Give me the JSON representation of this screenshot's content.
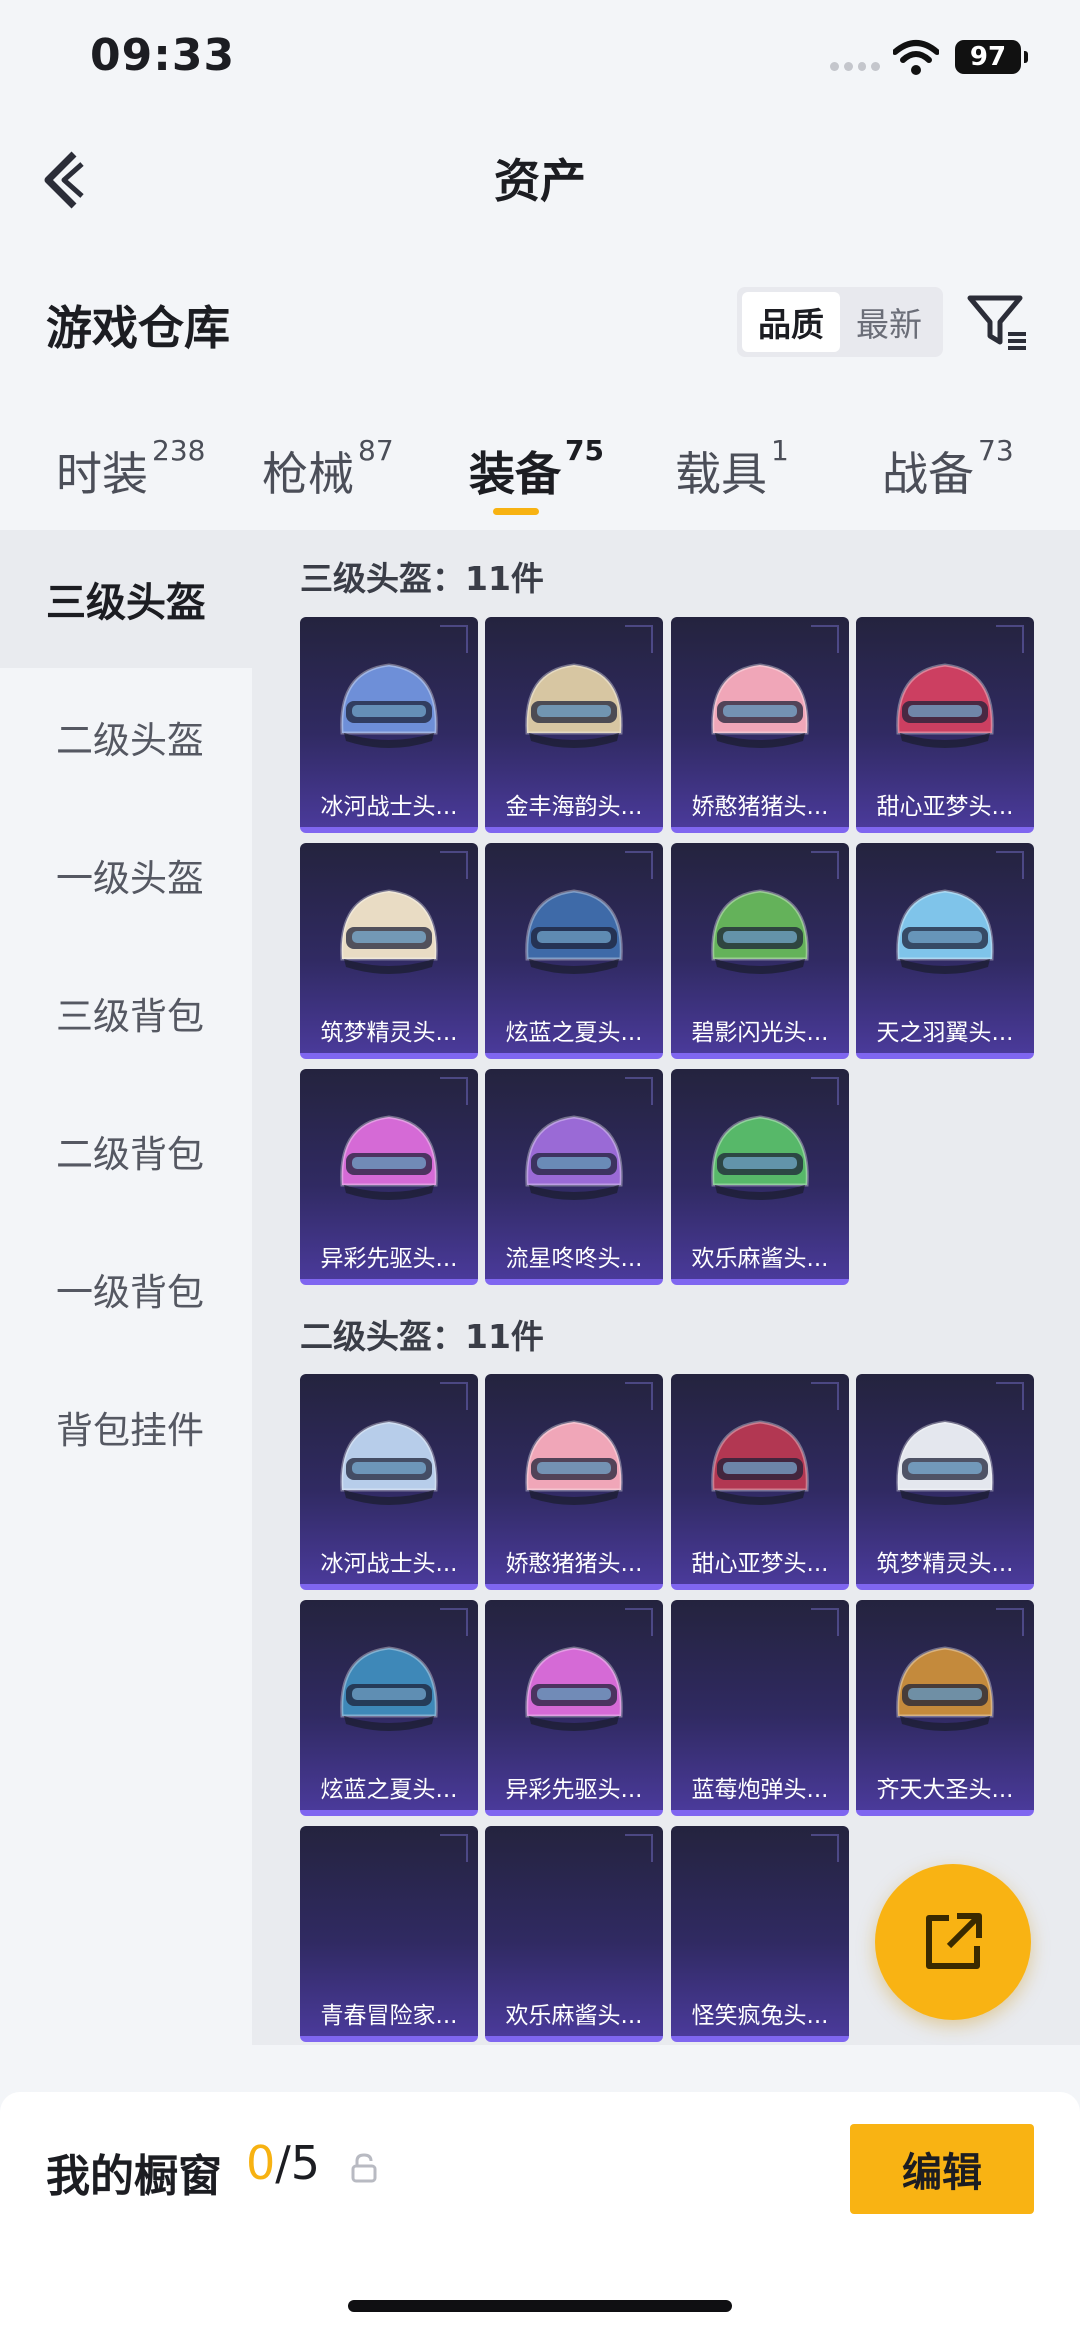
{
  "status": {
    "time": "09:33",
    "battery": "97"
  },
  "nav": {
    "title": "资产"
  },
  "header": {
    "title": "游戏仓库",
    "sort_quality": "品质",
    "sort_latest": "最新"
  },
  "tabs": [
    {
      "label": "时装",
      "count": "238"
    },
    {
      "label": "枪械",
      "count": "87"
    },
    {
      "label": "装备",
      "count": "75"
    },
    {
      "label": "载具",
      "count": "1"
    },
    {
      "label": "战备",
      "count": "73"
    }
  ],
  "sidebar": {
    "items": [
      "三级头盔",
      "二级头盔",
      "一级头盔",
      "三级背包",
      "二级背包",
      "一级背包",
      "背包挂件"
    ]
  },
  "groups": [
    {
      "title": "三级头盔：11件",
      "items": [
        {
          "label": "冰河战士头...",
          "color": "#6e8fd8"
        },
        {
          "label": "金丰海韵头...",
          "color": "#d7c6a2"
        },
        {
          "label": "娇憨猪猪头...",
          "color": "#f0a6b8"
        },
        {
          "label": "甜心亚梦头...",
          "color": "#cc3f61"
        },
        {
          "label": "筑梦精灵头...",
          "color": "#e9dcc4"
        },
        {
          "label": "炫蓝之夏头...",
          "color": "#3e6aa8"
        },
        {
          "label": "碧影闪光头...",
          "color": "#64b25a"
        },
        {
          "label": "天之羽翼头...",
          "color": "#7fc4ea"
        },
        {
          "label": "异彩先驱头...",
          "color": "#d56ad6"
        },
        {
          "label": "流星咚咚头...",
          "color": "#9a6ad6"
        },
        {
          "label": "欢乐麻酱头...",
          "color": "#57b869"
        }
      ]
    },
    {
      "title": "二级头盔：11件",
      "items": [
        {
          "label": "冰河战士头...",
          "color": "#b7cdea"
        },
        {
          "label": "娇憨猪猪头...",
          "color": "#f0a6b8"
        },
        {
          "label": "甜心亚梦头...",
          "color": "#b23752"
        },
        {
          "label": "筑梦精灵头...",
          "color": "#e4e7ee"
        },
        {
          "label": "炫蓝之夏头...",
          "color": "#3e88b8"
        },
        {
          "label": "异彩先驱头...",
          "color": "#d56ad6"
        },
        {
          "label": "蓝莓炮弹头...",
          "color": ""
        },
        {
          "label": "齐天大圣头...",
          "color": "#c48a3c"
        },
        {
          "label": "青春冒险家...",
          "color": ""
        },
        {
          "label": "欢乐麻酱头...",
          "color": ""
        },
        {
          "label": "怪笑疯兔头...",
          "color": ""
        }
      ]
    }
  ],
  "bottom": {
    "showcase_label": "我的橱窗",
    "current": "0",
    "total": "/5",
    "edit_label": "编辑"
  },
  "colors": {
    "accent": "#f9b313",
    "card_border": "#7f66f0"
  }
}
